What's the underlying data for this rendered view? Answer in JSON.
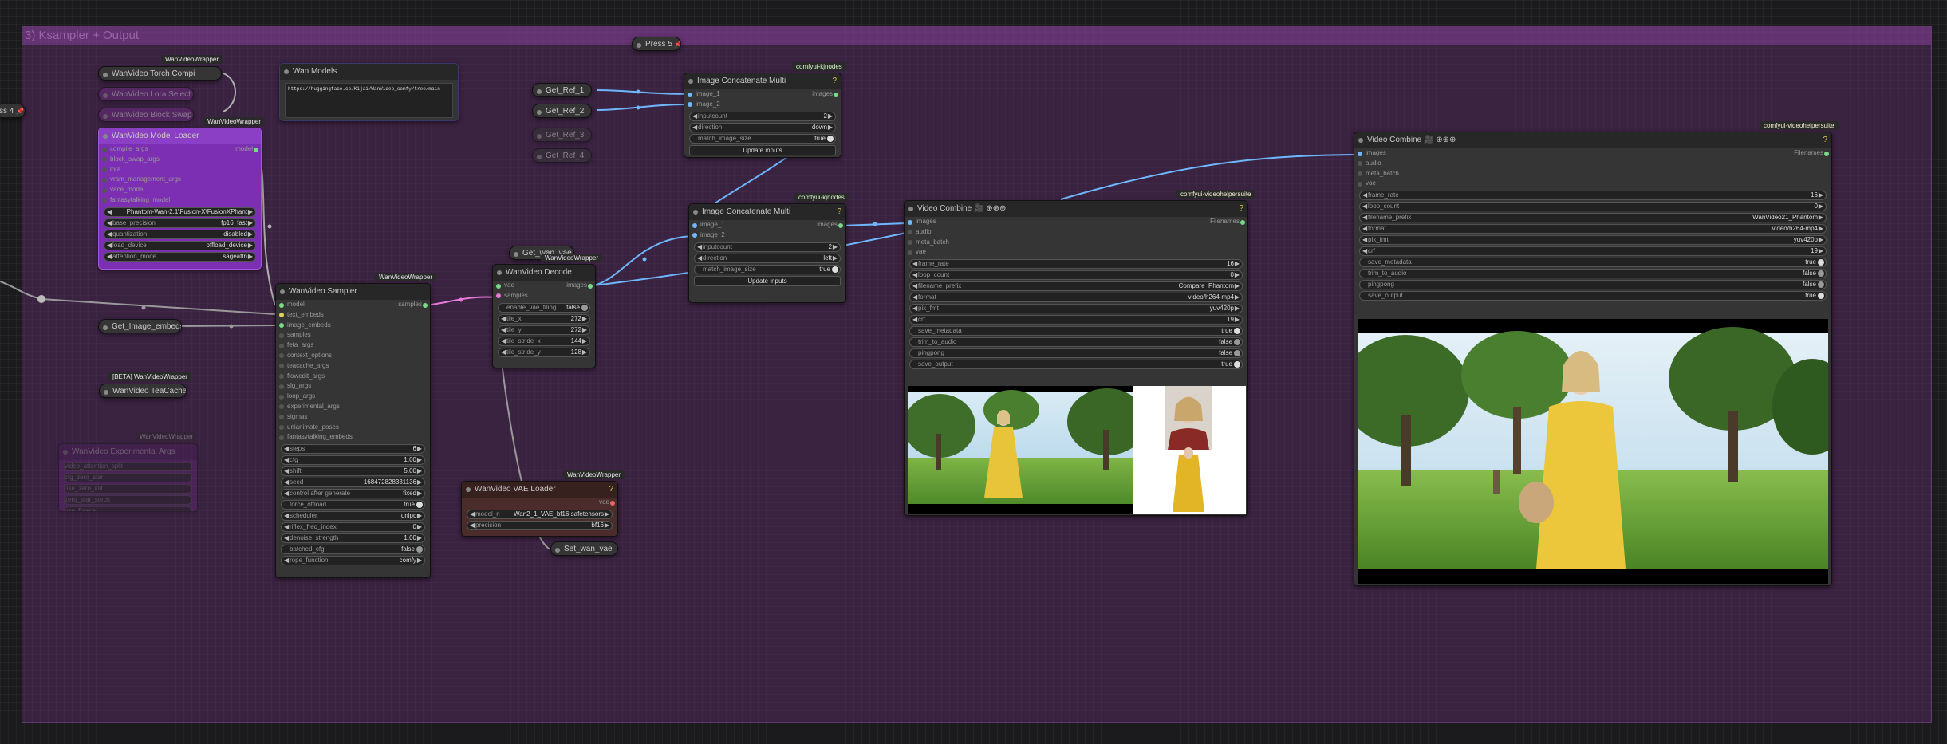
{
  "group": {
    "title": "3) Ksampler + Output"
  },
  "press": {
    "title": "Press 5",
    "pin": "📌"
  },
  "left_edge": {
    "label": "ss 4"
  },
  "badges": {
    "wanvideowrapper": "WanVideoWrapper",
    "kjnodes": "comfyui-kjnodes",
    "vhs": "comfyui-videohelpersuite",
    "beta_wanvideowrapper": "[BETA] WanVideoWrapper"
  },
  "torch_compile": {
    "title": "WanVideo Torch Compi"
  },
  "hidden_nodes": {
    "a": "WanVideo Lora Select",
    "b": "WanVideo Block Swap"
  },
  "model_loader": {
    "title": "WanVideo Model Loader",
    "inputs": [
      "compile_args",
      "block_swap_args",
      "lora",
      "vram_management_args",
      "vace_model",
      "fantasytalking_model"
    ],
    "output": "model",
    "widgets": [
      {
        "label": "",
        "value": "Phantom-Wan-2.1\\Fusion-X\\FusionXPhant"
      },
      {
        "label": "base_precision",
        "value": "fp16_fast"
      },
      {
        "label": "quantization",
        "value": "disabled"
      },
      {
        "label": "load_device",
        "value": "offload_device"
      },
      {
        "label": "attention_mode",
        "value": "sageattn"
      }
    ]
  },
  "wan_models": {
    "title": "Wan Models",
    "text": "https://huggingface.co/Kijai/WanVideo_comfy/tree/main"
  },
  "get_image_embeds": {
    "title": "Get_Image_embeds"
  },
  "teacache": {
    "title": "WanVideo TeaCache"
  },
  "faded_node": {
    "title": "WanVideo Experimental Args",
    "rows": [
      "video_attention_split",
      "cfg_zero_star",
      "use_zero_init",
      "zero_star_steps",
      "use_fresca"
    ]
  },
  "sampler": {
    "title": "WanVideo Sampler",
    "inputs": [
      "model",
      "text_embeds",
      "image_embeds",
      "samples",
      "feta_args",
      "context_options",
      "teacache_args",
      "flowedit_args",
      "slg_args",
      "loop_args",
      "experimental_args",
      "sigmas",
      "unianimate_poses",
      "fantasytalking_embeds"
    ],
    "output": "samples",
    "widgets": [
      {
        "label": "steps",
        "value": "6"
      },
      {
        "label": "cfg",
        "value": "1.00"
      },
      {
        "label": "shift",
        "value": "5.00"
      },
      {
        "label": "seed",
        "value": "168472828331136"
      },
      {
        "label": "control after generate",
        "value": "fixed"
      },
      {
        "label": "force_offload",
        "value": "true"
      },
      {
        "label": "scheduler",
        "value": "unipc"
      },
      {
        "label": "riflex_freq_index",
        "value": "0"
      },
      {
        "label": "denoise_strength",
        "value": "1.00"
      },
      {
        "label": "batched_cfg",
        "value": "false"
      },
      {
        "label": "rope_function",
        "value": "comfy"
      }
    ]
  },
  "get_wan_vae": {
    "title": "Get_wan_vae"
  },
  "vae_decode": {
    "title": "WanVideo Decode",
    "inputs": [
      "vae",
      "samples"
    ],
    "output": "images",
    "widgets": [
      {
        "label": "enable_vae_tiling",
        "value": "false"
      },
      {
        "label": "tile_x",
        "value": "272"
      },
      {
        "label": "tile_y",
        "value": "272"
      },
      {
        "label": "tile_stride_x",
        "value": "144"
      },
      {
        "label": "tile_stride_y",
        "value": "128"
      }
    ]
  },
  "vae_loader": {
    "title": "WanVideo VAE Loader",
    "output": "vae",
    "widgets": [
      {
        "label": "model_n",
        "value": "Wan2_1_VAE_bf16.safetensors"
      },
      {
        "label": "precision",
        "value": "bf16"
      }
    ]
  },
  "set_wan_vae": {
    "title": "Set_wan_vae"
  },
  "get_refs": [
    "Get_Ref_1",
    "Get_Ref_2",
    "Get_Ref_3",
    "Get_Ref_4"
  ],
  "concat1": {
    "title": "Image Concatenate Multi",
    "inputs": [
      "image_1",
      "image_2"
    ],
    "output": "images",
    "widgets": [
      {
        "label": "inputcount",
        "value": "2"
      },
      {
        "label": "direction",
        "value": "down"
      },
      {
        "label": "match_image_size",
        "value": "true"
      }
    ],
    "button": "Update inputs"
  },
  "concat2": {
    "title": "Image Concatenate Multi",
    "inputs": [
      "image_1",
      "image_2"
    ],
    "output": "images",
    "widgets": [
      {
        "label": "inputcount",
        "value": "2"
      },
      {
        "label": "direction",
        "value": "left"
      },
      {
        "label": "match_image_size",
        "value": "true"
      }
    ],
    "button": "Update inputs"
  },
  "combine_small": {
    "title": "Video Combine",
    "icons": "🎥 ⊕⊕⊕",
    "inputs": [
      "images",
      "audio",
      "meta_batch",
      "vae"
    ],
    "output": "Filenames",
    "widgets": [
      {
        "label": "frame_rate",
        "value": "16"
      },
      {
        "label": "loop_count",
        "value": "0"
      },
      {
        "label": "filename_prefix",
        "value": "Compare_Phantom"
      },
      {
        "label": "format",
        "value": "video/h264-mp4"
      },
      {
        "label": "pix_fmt",
        "value": "yuv420p"
      },
      {
        "label": "crf",
        "value": "19"
      },
      {
        "label": "save_metadata",
        "value": "true"
      },
      {
        "label": "trim_to_audio",
        "value": "false"
      },
      {
        "label": "pingpong",
        "value": "false"
      },
      {
        "label": "save_output",
        "value": "true"
      }
    ]
  },
  "combine_large": {
    "title": "Video Combine",
    "icons": "🎥 ⊕⊕⊕",
    "inputs": [
      "images",
      "audio",
      "meta_batch",
      "vae"
    ],
    "output": "Filenames",
    "widgets": [
      {
        "label": "frame_rate",
        "value": "16"
      },
      {
        "label": "loop_count",
        "value": "0"
      },
      {
        "label": "filename_prefix",
        "value": "WanVideo21_Phantom"
      },
      {
        "label": "format",
        "value": "video/h264-mp4"
      },
      {
        "label": "pix_fmt",
        "value": "yuv420p"
      },
      {
        "label": "crf",
        "value": "19"
      },
      {
        "label": "save_metadata",
        "value": "true"
      },
      {
        "label": "trim_to_audio",
        "value": "false"
      },
      {
        "label": "pingpong",
        "value": "false"
      },
      {
        "label": "save_output",
        "value": "true"
      }
    ]
  },
  "colors": {
    "canvas": "#1b1b1d",
    "group": "#5a2f6a",
    "node": "#353535",
    "purple_node": "#7c2fb2",
    "link_blue": "#6fb7ff",
    "link_pink": "#e779d8",
    "link_gray": "#9a9a9a"
  }
}
